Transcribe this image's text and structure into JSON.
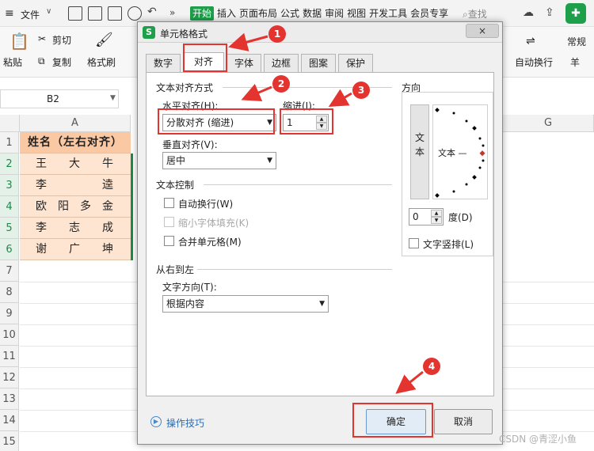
{
  "menubar": {
    "file_label": "文件",
    "tabs": [
      "开始",
      "插入",
      "页面布局",
      "公式",
      "数据",
      "审阅",
      "视图",
      "开发工具",
      "会员专享"
    ],
    "search_label": "查找"
  },
  "ribbon": {
    "paste": "粘贴",
    "cut": "剪切",
    "copy": "复制",
    "format_painter": "格式刷",
    "wrap_text": "自动换行",
    "number_format": "常规",
    "currency_symbol": "羊"
  },
  "namebox": {
    "value": "B2"
  },
  "sheet": {
    "columns": [
      "A",
      "G"
    ],
    "rows": [
      "1",
      "2",
      "3",
      "4",
      "5",
      "6",
      "7",
      "8",
      "9",
      "10",
      "11",
      "12",
      "13",
      "14",
      "15"
    ],
    "header_cell": "姓名（左右对齐）",
    "names": [
      [
        "王",
        "大",
        "牛"
      ],
      [
        "李",
        "逵"
      ],
      [
        "欧",
        "阳",
        "多",
        "金"
      ],
      [
        "李",
        "志",
        "成"
      ],
      [
        "谢",
        "广",
        "坤"
      ]
    ]
  },
  "dialog": {
    "title": "单元格格式",
    "close_label": "×",
    "tabs": [
      "数字",
      "对齐",
      "字体",
      "边框",
      "图案",
      "保护"
    ],
    "active_tab": "对齐",
    "text_align_group": "文本对齐方式",
    "horizontal_label": "水平对齐(H):",
    "horizontal_value": "分散对齐 (缩进)",
    "indent_label": "缩进(I):",
    "indent_value": "1",
    "vertical_label": "垂直对齐(V):",
    "vertical_value": "居中",
    "text_control_group": "文本控制",
    "wrap_label": "自动换行(W)",
    "shrink_label": "缩小字体填充(K)",
    "merge_label": "合并单元格(M)",
    "rtl_group": "从右到左",
    "direction_label": "文字方向(T):",
    "direction_value": "根据内容",
    "orientation_group": "方向",
    "vertical_text": "文本",
    "dial_text": "文本 —",
    "degree_value": "0",
    "degree_label": "度(D)",
    "vertical_layout_label": "文字竖排(L)",
    "tips_label": "操作技巧",
    "ok_label": "确定",
    "cancel_label": "取消"
  },
  "annotations": [
    "1",
    "2",
    "3",
    "4"
  ],
  "colors": {
    "accent_green": "#1ea04b",
    "annotation_red": "#e3342f",
    "header_fill": "#fac9a4",
    "data_fill": "#fde5d2"
  },
  "watermark": "CSDN @青涩小鱼"
}
